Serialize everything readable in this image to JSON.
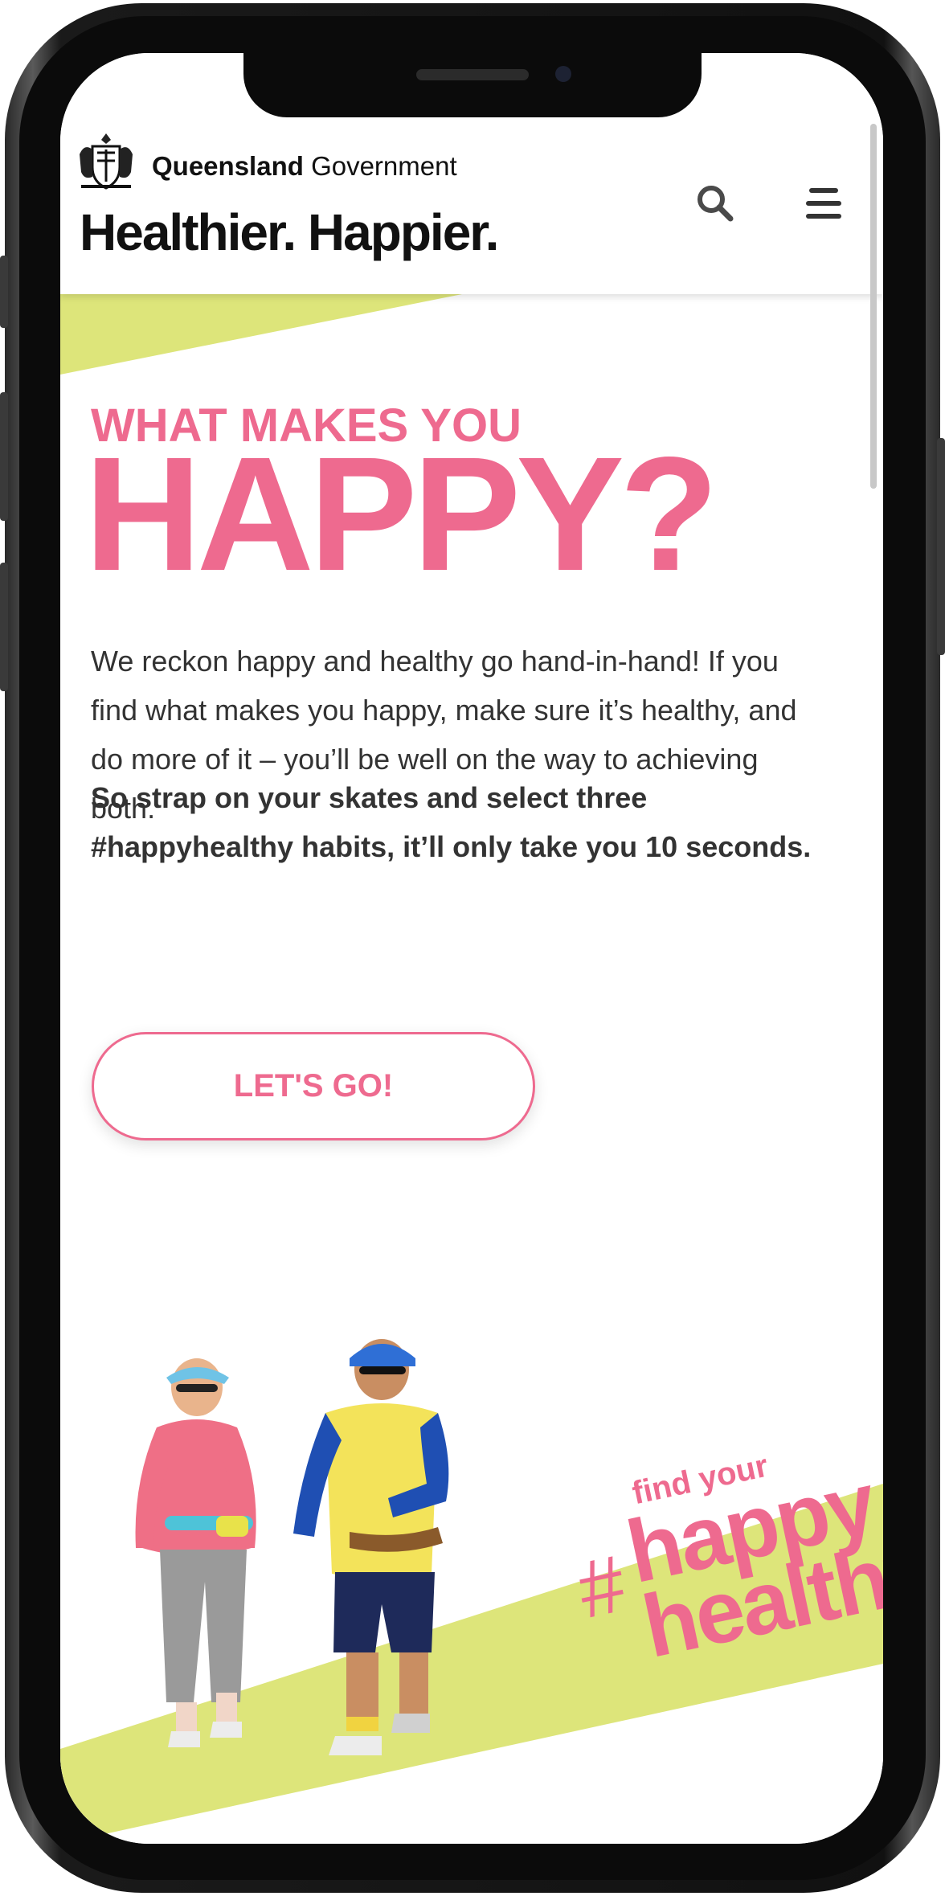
{
  "colors": {
    "accent_pink": "#ee6a8f",
    "accent_lime": "#dde57a",
    "text_dark": "#333333"
  },
  "header": {
    "gov_name_bold": "Queensland",
    "gov_name_rest": "Government",
    "site_title": "Healthier. Happier.",
    "search_icon": "search-icon",
    "menu_icon": "hamburger-menu-icon"
  },
  "hero": {
    "kicker": "WHAT MAKES YOU",
    "headline": "HAPPY?",
    "intro": "We reckon happy and healthy go hand-in-hand! If you find what makes you happy, make sure it’s healthy, and do more of it – you’ll be well on the way to achieving both.",
    "cta_text": "So strap on your skates and select three #happyhealthy habits, it’ll only take you 10 seconds.",
    "button_label": "LET'S GO!"
  },
  "campaign": {
    "hash": "#",
    "find": "find your",
    "happy": "happy",
    "healthy": "healthy"
  }
}
